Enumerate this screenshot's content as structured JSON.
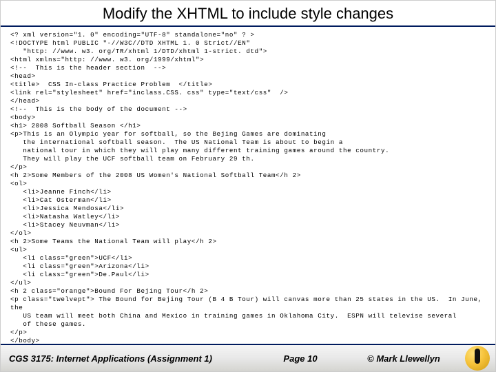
{
  "title": "Modify the XHTML to include style changes",
  "code": "<? xml version=\"1. 0\" encoding=\"UTF-8\" standalone=\"no\" ? >\n<!DOCTYPE html PUBLIC \"-//W3C//DTD XHTML 1. 0 Strict//EN\"\n   \"http: //www. w3. org/TR/xhtml 1/DTD/xhtml 1-strict. dtd\">\n<html xmlns=\"http: //www. w3. org/1999/xhtml\">\n<!--  This is the header section  -->\n<head>\n<title>  CSS In-class Practice Problem  </title>\n<link rel=\"stylesheet\" href=\"inclass.CSS. css\" type=\"text/css\"  />\n</head>\n<!--  This is the body of the document -->\n<body>\n<h1> 2008 Softball Season </h1>\n<p>This is an Olympic year for softball, so the Bejing Games are dominating\n   the international softball season.  The US National Team is about to begin a\n   national tour in which they will play many different training games around the country.\n   They will play the UCF softball team on February 29 th.\n</p>\n<h 2>Some Members of the 2008 US Women's National Softball Team</h 2>\n<ol>\n   <li>Jeanne Finch</li>\n   <li>Cat Osterman</li>\n   <li>Jessica Mendosa</li>\n   <li>Natasha Watley</li>\n   <li>Stacey Neuvman</li>\n</ol>\n<h 2>Some Teams the National Team will play</h 2>\n<ul>\n   <li class=\"green\">UCF</li>\n   <li class=\"green\">Arizona</li>\n   <li class=\"green\">De.Paul</li>\n</ul>\n<h 2 class=\"orange\">Bound For Bejing Tour</h 2>\n<p class=\"twelvept\"> The Bound for Bejing Tour (B 4 B Tour) will canvas more than 25 states in the US.  In June,\nthe\n   US team will meet both China and Mexico in training games in Oklahoma City.  ESPN will televise several\n   of these games.\n</p>\n</body>\n</html>",
  "footer": {
    "left": "CGS 3175: Internet Applications (Assignment 1)",
    "page": "Page 10",
    "right": "© Mark Llewellyn"
  },
  "logo_name": "ucf-pegasus-logo"
}
